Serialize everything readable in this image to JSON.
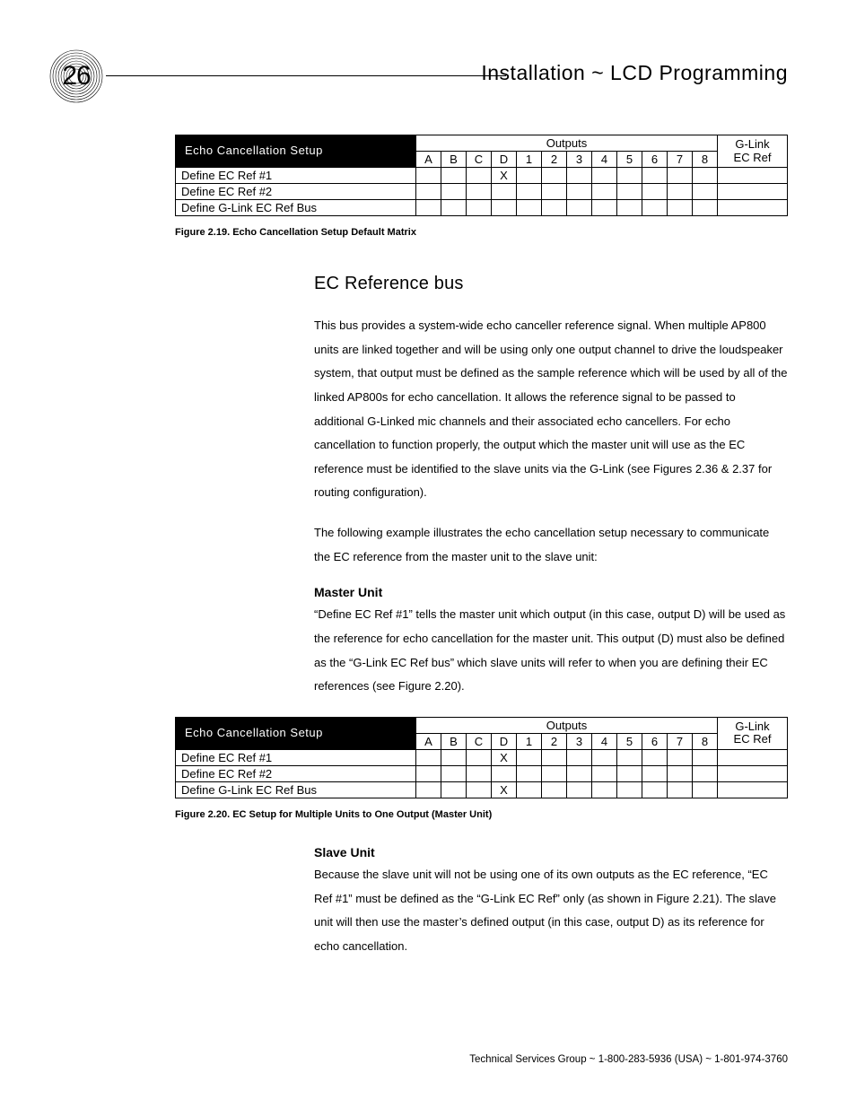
{
  "page_number": "26",
  "header_title": "Installation ~ LCD Programming",
  "matrix_title": "Echo Cancellation Setup",
  "outputs_label": "Outputs",
  "glink_label_1": "G-Link",
  "glink_label_2": "EC Ref",
  "columns": [
    "A",
    "B",
    "C",
    "D",
    "1",
    "2",
    "3",
    "4",
    "5",
    "6",
    "7",
    "8"
  ],
  "rows": {
    "r1": "Define EC Ref #1",
    "r2": "Define EC Ref #2",
    "r3": "Define G-Link EC Ref Bus"
  },
  "x_mark": "X",
  "fig219_caption": "Figure 2.19.  Echo Cancellation Setup Default Matrix",
  "fig220_caption": "Figure 2.20.  EC Setup for Multiple Units to One Output (Master Unit)",
  "section_heading": "EC Reference bus",
  "para1": "This bus provides a system-wide echo canceller reference signal. When multiple AP800 units are linked together and will be using only one output channel to drive the loudspeaker system, that output must be defined as the sample reference which will be used by all of the linked AP800s for echo cancellation. It allows the reference signal to be passed to additional G-Linked mic channels and their associated echo cancellers. For echo cancellation to function properly, the output which the master unit will use as the EC reference must be identified to the slave units via the G-Link (see Figures 2.36 & 2.37 for routing configuration).",
  "para2": "The following example illustrates the echo cancellation setup necessary to communicate the EC reference from the master unit to the slave unit:",
  "master_heading": "Master Unit",
  "master_para": "“Define EC Ref #1” tells the master unit which output (in this case, output D) will be used as the reference for echo cancellation for the master unit. This output (D) must also be defined as the “G-Link EC Ref bus” which slave units will refer to when you are defining their EC references (see Figure 2.20).",
  "slave_heading": "Slave Unit",
  "slave_para": "Because the slave unit will not be using one of its own outputs as the EC reference, “EC Ref #1” must be defined as the “G-Link EC Ref” only (as shown in Figure 2.21). The slave unit will then use the master’s defined output (in this case, output D) as its reference for echo cancellation.",
  "footer": "Technical Services Group ~ 1-800-283-5936 (USA) ~ 1-801-974-3760"
}
